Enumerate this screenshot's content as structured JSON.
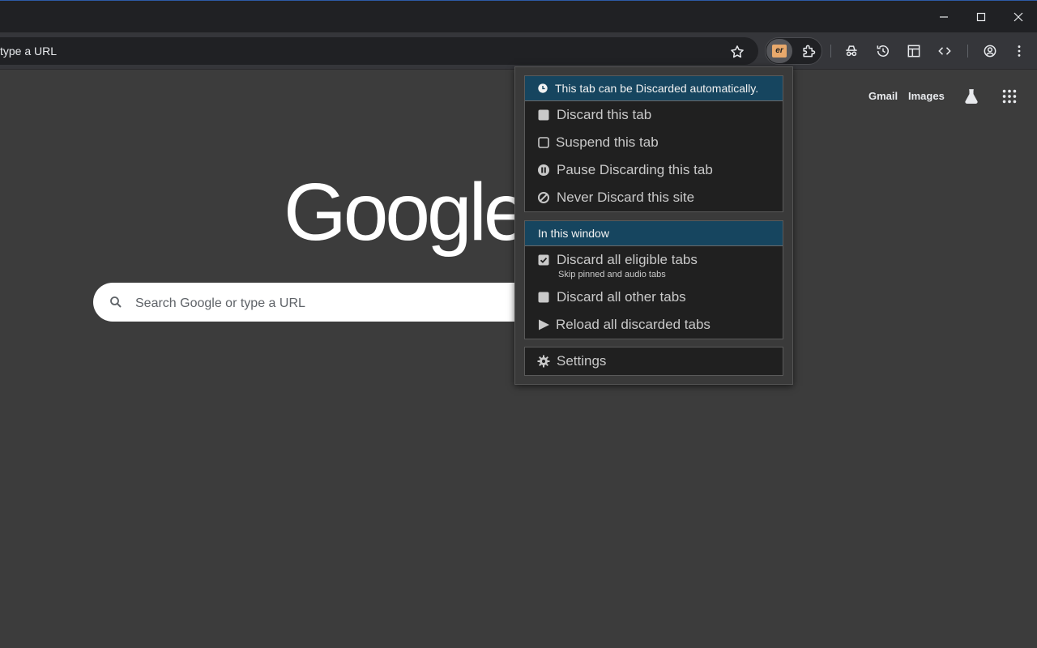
{
  "window": {
    "minimize_icon": "minimize-icon",
    "maximize_icon": "maximize-icon",
    "close_icon": "close-icon"
  },
  "omnibox": {
    "text": "type a URL"
  },
  "google": {
    "links": {
      "gmail": "Gmail",
      "images": "Images"
    },
    "logo": "Google",
    "search_placeholder": "Search Google or type a URL"
  },
  "popup": {
    "status": "This tab can be Discarded automatically.",
    "tab_actions": [
      {
        "label": "Discard this tab",
        "icon": "square-icon"
      },
      {
        "label": "Suspend this tab",
        "icon": "square-outline-icon"
      },
      {
        "label": "Pause Discarding this tab",
        "icon": "pause-circle-icon"
      },
      {
        "label": "Never Discard this site",
        "icon": "ban-icon"
      }
    ],
    "window_header": "In this window",
    "window_actions": [
      {
        "label": "Discard all eligible tabs",
        "sub": "Skip pinned and audio tabs",
        "icon": "checkbox-checked-icon"
      },
      {
        "label": "Discard all other tabs",
        "icon": "square-icon"
      },
      {
        "label": "Reload all discarded tabs",
        "icon": "play-icon"
      }
    ],
    "settings": "Settings"
  },
  "extension_badge": "er",
  "colors": {
    "popup_header": "#16455f",
    "page_bg": "#3c3c3c",
    "toolbar_bg": "#35363a"
  }
}
